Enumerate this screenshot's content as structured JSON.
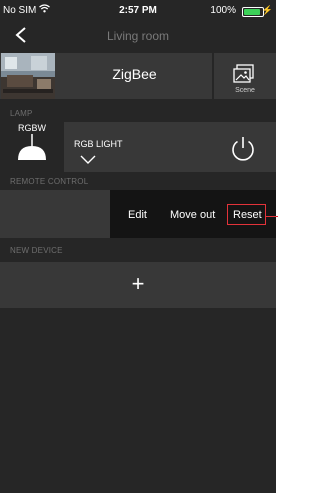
{
  "status": {
    "carrier": "No SIM",
    "time": "2:57 PM",
    "battery": "100%",
    "battery_color": "#3cd158"
  },
  "nav": {
    "title": "Living room"
  },
  "room": {
    "name": "ZigBee",
    "scene_label": "Scene"
  },
  "sections": {
    "lamp": "LAMP",
    "remote": "REMOTE CONTROL",
    "new_device": "NEW DEVICE"
  },
  "lamp": {
    "type": "RGBW",
    "name": "RGB LIGHT"
  },
  "remote": {
    "edit": "Edit",
    "move_out": "Move out",
    "reset": "Reset"
  },
  "new_device": {
    "plus": "+"
  },
  "colors": {
    "highlight": "#e2333a",
    "background": "#262626",
    "row": "#383838"
  }
}
